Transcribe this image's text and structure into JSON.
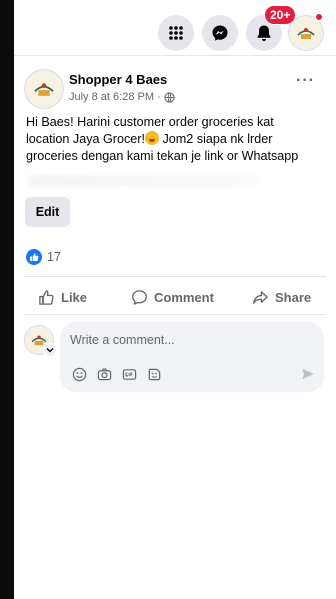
{
  "topbar": {
    "icons": [
      "menu-grid-icon",
      "messenger-icon",
      "bell-icon"
    ],
    "notification_count": "20+"
  },
  "post": {
    "author": "Shopper 4 Baes",
    "timestamp": "July 8 at 6:28 PM ·",
    "privacy_icon": "globe-icon",
    "more_label": "···",
    "text_line_1": "Hi Baes! Harini customer order groceries kat",
    "text_line_2": "location Jaya Grocer!",
    "text_line_2b": " Jom2 siapa nk lrder",
    "text_line_3": "groceries dengan kami tekan je link or Whatsapp",
    "edit_label": "Edit"
  },
  "reactions": {
    "count": "17"
  },
  "actions": {
    "like_label": "Like",
    "comment_label": "Comment",
    "share_label": "Share"
  },
  "composer": {
    "placeholder": "Write a comment..."
  },
  "colors": {
    "accent": "#1877f2",
    "badge": "#e41e3f",
    "muted_text": "#65676b",
    "divider": "#e4e6eb",
    "input_bg": "#f0f2f5"
  }
}
